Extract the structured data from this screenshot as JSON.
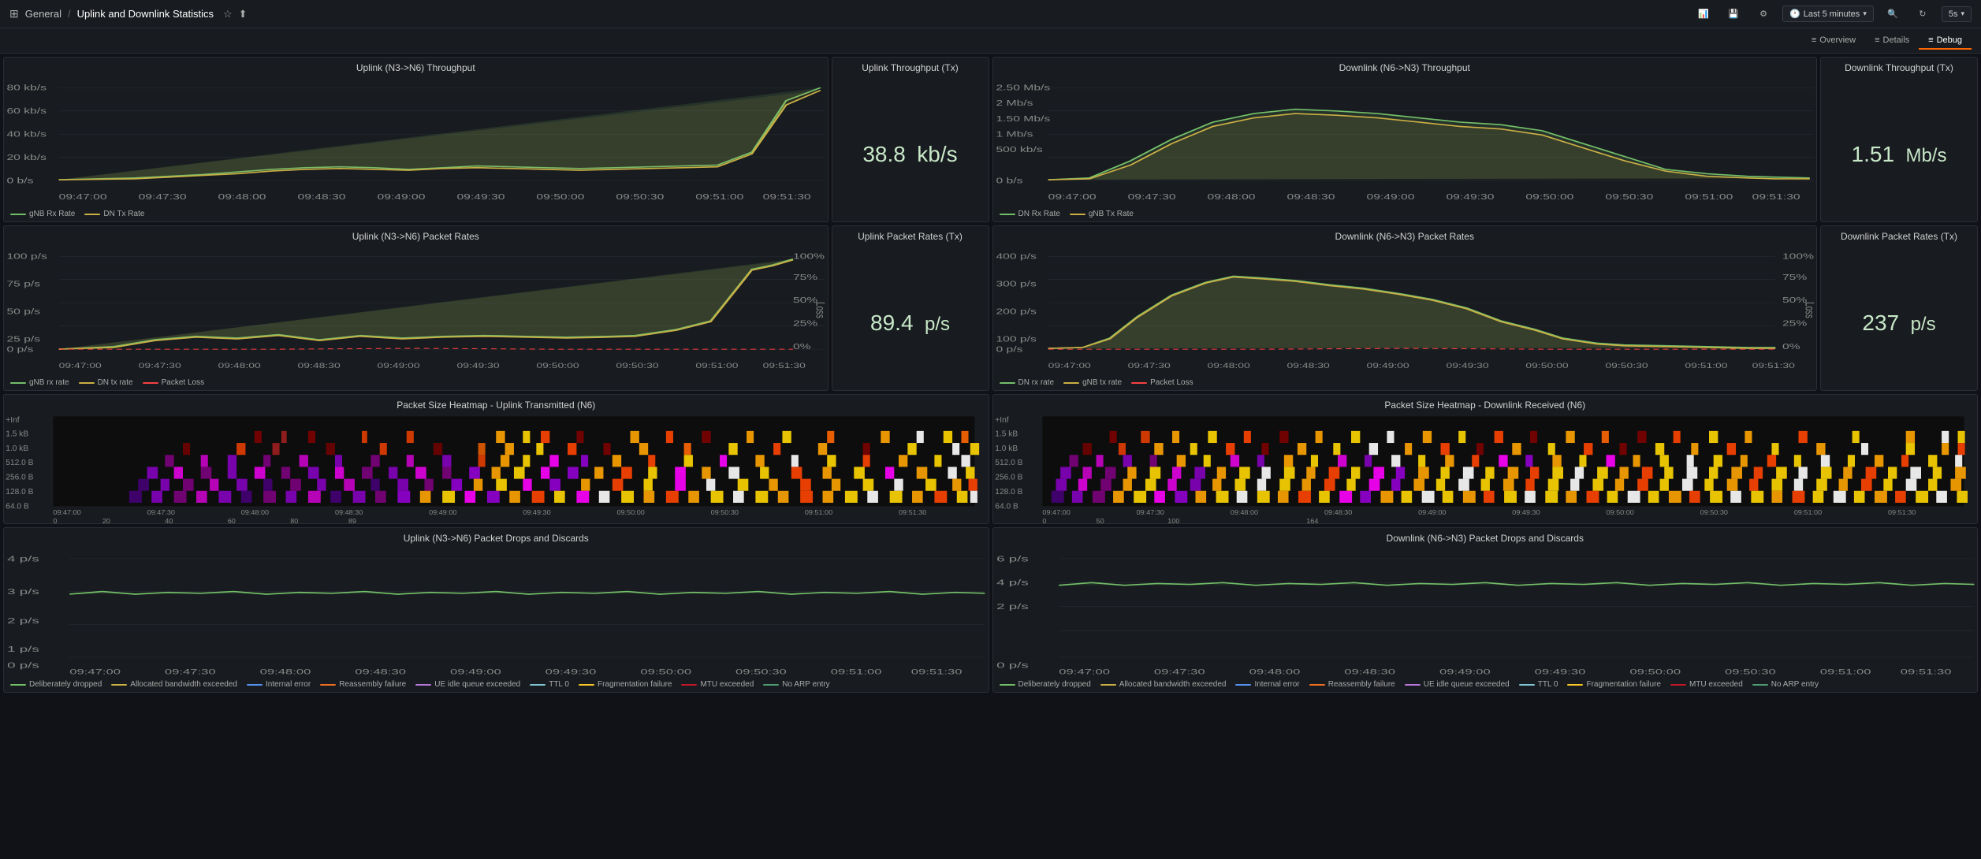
{
  "app": {
    "title": "General",
    "subtitle": "Uplink and Downlink Statistics"
  },
  "topbar": {
    "breadcrumb_sep": "/",
    "time_range": "Last 5 minutes",
    "refresh_interval": "5s"
  },
  "tabs": [
    {
      "label": "Overview",
      "icon": "≡",
      "active": false
    },
    {
      "label": "Details",
      "icon": "≡",
      "active": false
    },
    {
      "label": "Debug",
      "icon": "≡",
      "active": false
    }
  ],
  "panels": {
    "uplink_throughput": {
      "title": "Uplink (N3->N6) Throughput",
      "legend": [
        {
          "label": "gNB Rx Rate",
          "color": "#73bf69"
        },
        {
          "label": "DN Tx Rate",
          "color": "#caaf45"
        }
      ]
    },
    "uplink_throughput_tx": {
      "title": "Uplink Throughput (Tx)",
      "value": "38.8",
      "unit": "kb/s"
    },
    "downlink_throughput": {
      "title": "Downlink (N6->N3) Throughput",
      "legend": [
        {
          "label": "DN Rx Rate",
          "color": "#73bf69"
        },
        {
          "label": "gNB Tx Rate",
          "color": "#caaf45"
        }
      ]
    },
    "downlink_throughput_tx": {
      "title": "Downlink Throughput (Tx)",
      "value": "1.51",
      "unit": "Mb/s"
    },
    "uplink_packet_rates": {
      "title": "Uplink (N3->N6) Packet Rates",
      "legend": [
        {
          "label": "gNB rx rate",
          "color": "#73bf69"
        },
        {
          "label": "DN tx rate",
          "color": "#caaf45"
        },
        {
          "label": "Packet Loss",
          "color": "#f74040",
          "dashed": true
        }
      ]
    },
    "uplink_packet_rates_tx": {
      "title": "Uplink Packet Rates (Tx)",
      "value": "89.4",
      "unit": "p/s"
    },
    "downlink_packet_rates": {
      "title": "Downlink (N6->N3) Packet Rates",
      "legend": [
        {
          "label": "DN rx rate",
          "color": "#73bf69"
        },
        {
          "label": "gNB tx rate",
          "color": "#caaf45"
        },
        {
          "label": "Packet Loss",
          "color": "#f74040",
          "dashed": true
        }
      ]
    },
    "downlink_packet_rates_tx": {
      "title": "Downlink Packet Rates (Tx)",
      "value": "237",
      "unit": "p/s"
    },
    "heatmap_uplink": {
      "title": "Packet Size Heatmap - Uplink Transmitted (N6)"
    },
    "heatmap_downlink": {
      "title": "Packet Size Heatmap - Downlink Received (N6)"
    },
    "uplink_drops": {
      "title": "Uplink (N3->N6) Packet Drops and Discards",
      "legend": [
        {
          "label": "Deliberately dropped",
          "color": "#73bf69"
        },
        {
          "label": "Allocated bandwidth exceeded",
          "color": "#caaf45"
        },
        {
          "label": "Internal error",
          "color": "#5794f2"
        },
        {
          "label": "Reassembly failure",
          "color": "#f26f22"
        },
        {
          "label": "UE idle queue exceeded",
          "color": "#b877d9"
        },
        {
          "label": "TTL 0",
          "color": "#80c4d4"
        },
        {
          "label": "Fragmentation failure",
          "color": "#f7c726"
        },
        {
          "label": "MTU exceeded",
          "color": "#c4162a"
        },
        {
          "label": "No ARP entry",
          "color": "#4e9c6f"
        }
      ]
    },
    "downlink_drops": {
      "title": "Downlink (N6->N3) Packet Drops and Discards",
      "legend": [
        {
          "label": "Deliberately dropped",
          "color": "#73bf69"
        },
        {
          "label": "Allocated bandwidth exceeded",
          "color": "#caaf45"
        },
        {
          "label": "Internal error",
          "color": "#5794f2"
        },
        {
          "label": "Reassembly failure",
          "color": "#f26f22"
        },
        {
          "label": "UE idle queue exceeded",
          "color": "#b877d9"
        },
        {
          "label": "TTL 0",
          "color": "#80c4d4"
        },
        {
          "label": "Fragmentation failure",
          "color": "#f7c726"
        },
        {
          "label": "MTU exceeded",
          "color": "#c4162a"
        },
        {
          "label": "No ARP entry",
          "color": "#4e9c6f"
        }
      ]
    }
  },
  "time_labels": [
    "09:47:00",
    "09:47:30",
    "09:48:00",
    "09:48:30",
    "09:49:00",
    "09:49:30",
    "09:50:00",
    "09:50:30",
    "09:51:00",
    "09:51:30"
  ]
}
